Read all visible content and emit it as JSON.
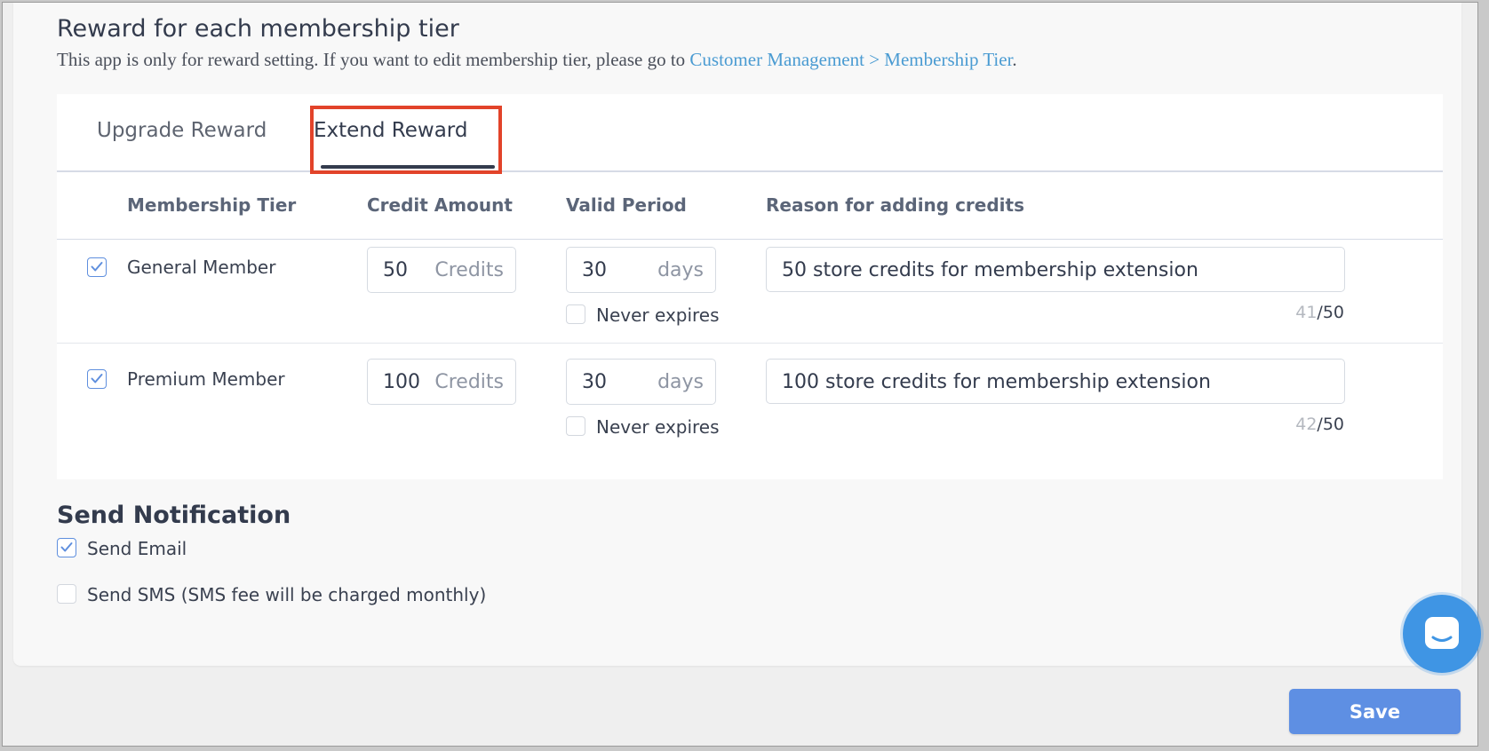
{
  "header": {
    "title": "Reward for each membership tier",
    "subtitle_prefix": "This app is only for reward setting. If you want to edit membership tier, please go to ",
    "subtitle_link": "Customer Management > Membership Tier",
    "subtitle_suffix": "."
  },
  "tabs": [
    {
      "label": "Upgrade Reward",
      "active": false
    },
    {
      "label": "Extend Reward",
      "active": true
    }
  ],
  "table": {
    "columns": [
      "Membership Tier",
      "Credit Amount",
      "Valid Period",
      "Reason for adding credits"
    ],
    "rows": [
      {
        "checked": true,
        "tier": "General Member",
        "credit_value": "50",
        "credit_unit": "Credits",
        "period_value": "30",
        "period_unit": "days",
        "never_expires_label": "Never expires",
        "never_expires_checked": false,
        "reason": "50 store credits for membership extension",
        "count": "41",
        "max": "/50"
      },
      {
        "checked": true,
        "tier": "Premium Member",
        "credit_value": "100",
        "credit_unit": "Credits",
        "period_value": "30",
        "period_unit": "days",
        "never_expires_label": "Never expires",
        "never_expires_checked": false,
        "reason": "100 store credits for membership extension",
        "count": "42",
        "max": "/50"
      }
    ]
  },
  "notification": {
    "title": "Send Notification",
    "send_email_label": "Send Email",
    "send_email_checked": true,
    "send_sms_label": "Send SMS (SMS fee will be charged monthly)",
    "send_sms_checked": false
  },
  "actions": {
    "save_label": "Save"
  },
  "chat": {
    "icon": "chat-icon"
  },
  "colors": {
    "accent": "#5e8fe3",
    "link": "#4a9bd2",
    "highlight": "#e2432a",
    "chat": "#3f95e4"
  }
}
